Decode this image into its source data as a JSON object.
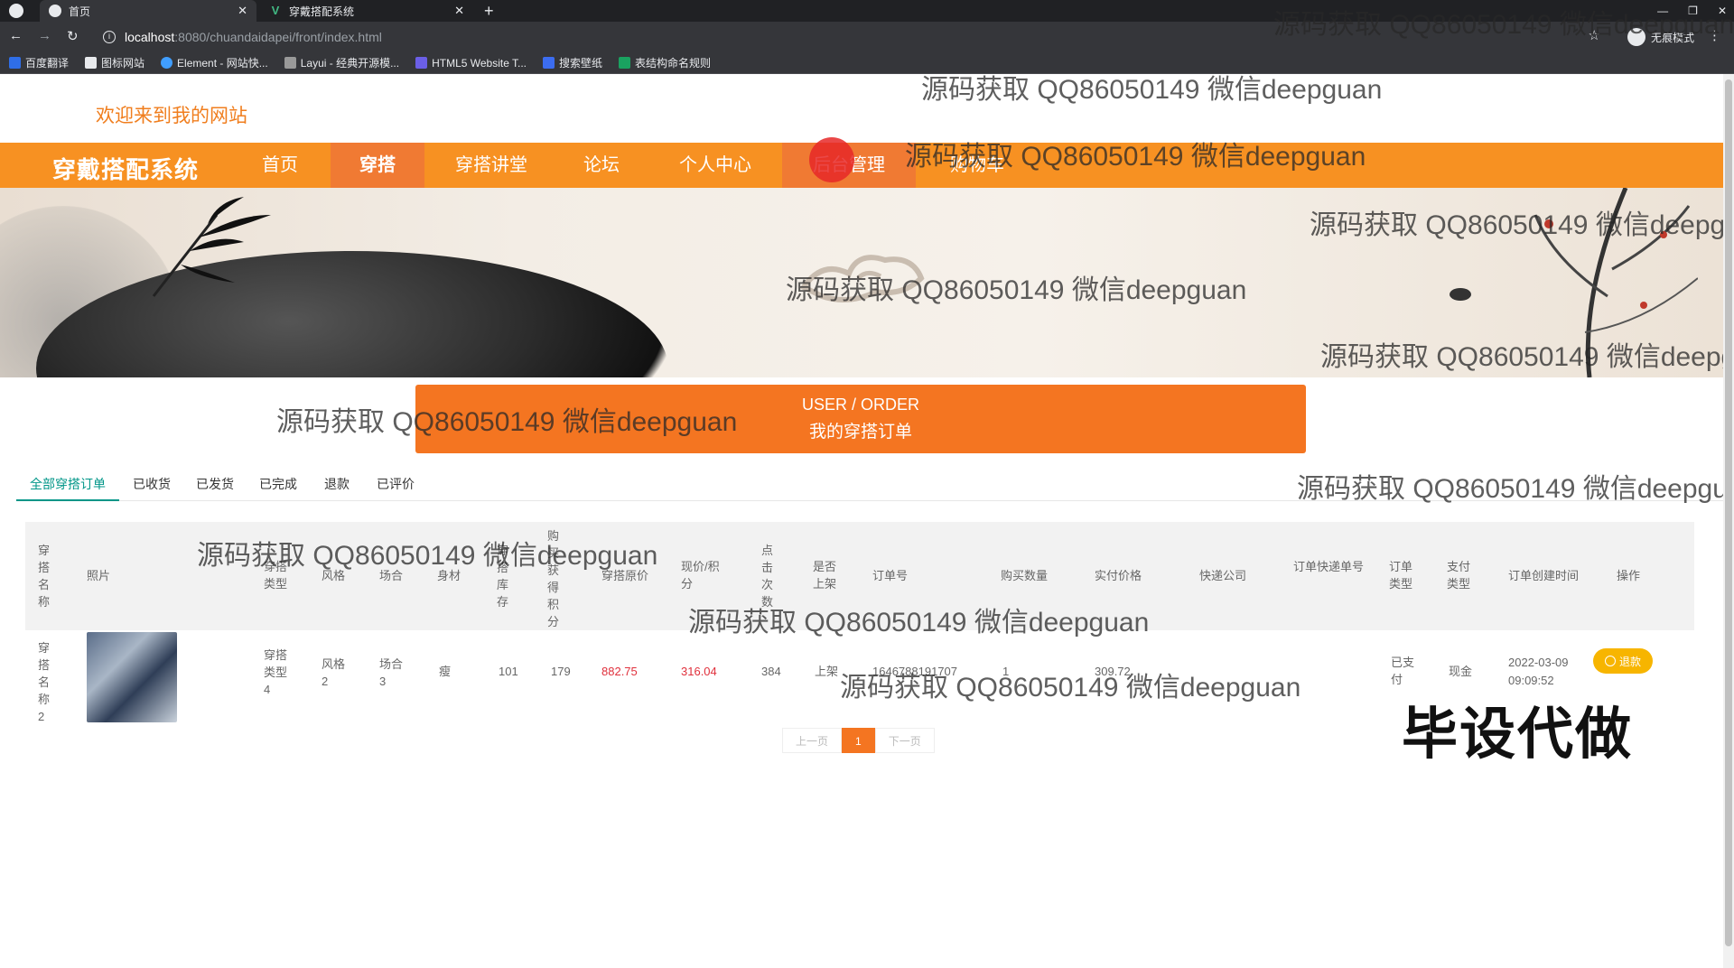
{
  "browser": {
    "tabs": [
      {
        "title": "首页",
        "active": true
      },
      {
        "title": "穿戴搭配系统",
        "active": false
      }
    ],
    "url_host": "localhost",
    "url_path": ":8080/chuandaidapei/front/index.html",
    "profile_label": "无痕模式",
    "bookmarks": [
      "百度翻译",
      "图标网站",
      "Element - 网站快...",
      "Layui - 经典开源模...",
      "HTML5 Website T...",
      "搜索壁纸",
      "表结构命名规则"
    ]
  },
  "header": {
    "welcome": "欢迎来到我的网站",
    "brand": "穿戴搭配系统",
    "nav": [
      "首页",
      "穿搭",
      "穿搭讲堂",
      "论坛",
      "个人中心",
      "后台管理",
      "购物车"
    ],
    "nav_active": "穿搭"
  },
  "hero": {
    "title_en": "USER / ORDER",
    "title_cn": "我的穿搭订单"
  },
  "order_tabs": [
    "全部穿搭订单",
    "已收货",
    "已发货",
    "已完成",
    "退款",
    "已评价"
  ],
  "table": {
    "headers": [
      "穿搭名称",
      "照片",
      "穿搭类型",
      "风格",
      "场合",
      "身材",
      "穿搭库存",
      "购买获得积分",
      "穿搭原价",
      "现价/积分",
      "点击次数",
      "是否上架",
      "订单号",
      "购买数量",
      "实付价格",
      "快递公司",
      "订单快递单号",
      "订单类型",
      "支付类型",
      "订单创建时间",
      "操作"
    ],
    "rows": [
      {
        "name": "穿搭名称2",
        "type": "穿搭类型4",
        "style": "风格2",
        "occasion": "场合3",
        "figure": "瘦",
        "stock": "101",
        "points": "179",
        "orig_price": "882.75",
        "price": "316.04",
        "clicks": "384",
        "shelf": "上架",
        "order_no": "1646788191707",
        "qty": "1",
        "paid": "309.72",
        "courier": "",
        "tracking": "",
        "order_type": "已支付",
        "pay_type": "现金",
        "created_date": "2022-03-09",
        "created_time": "09:09:52",
        "action": "退款"
      }
    ]
  },
  "pager": {
    "prev": "上一页",
    "current": "1",
    "next": "下一页"
  },
  "watermark_text": "源码获取 QQ86050149 微信deepguan",
  "overlay_tag": "毕设代做",
  "colors": {
    "brand_orange": "#f79122",
    "hero_orange": "#f47521",
    "tab_active": "#009688",
    "price_red": "#e0303c",
    "refund_yellow": "#f7b500"
  }
}
